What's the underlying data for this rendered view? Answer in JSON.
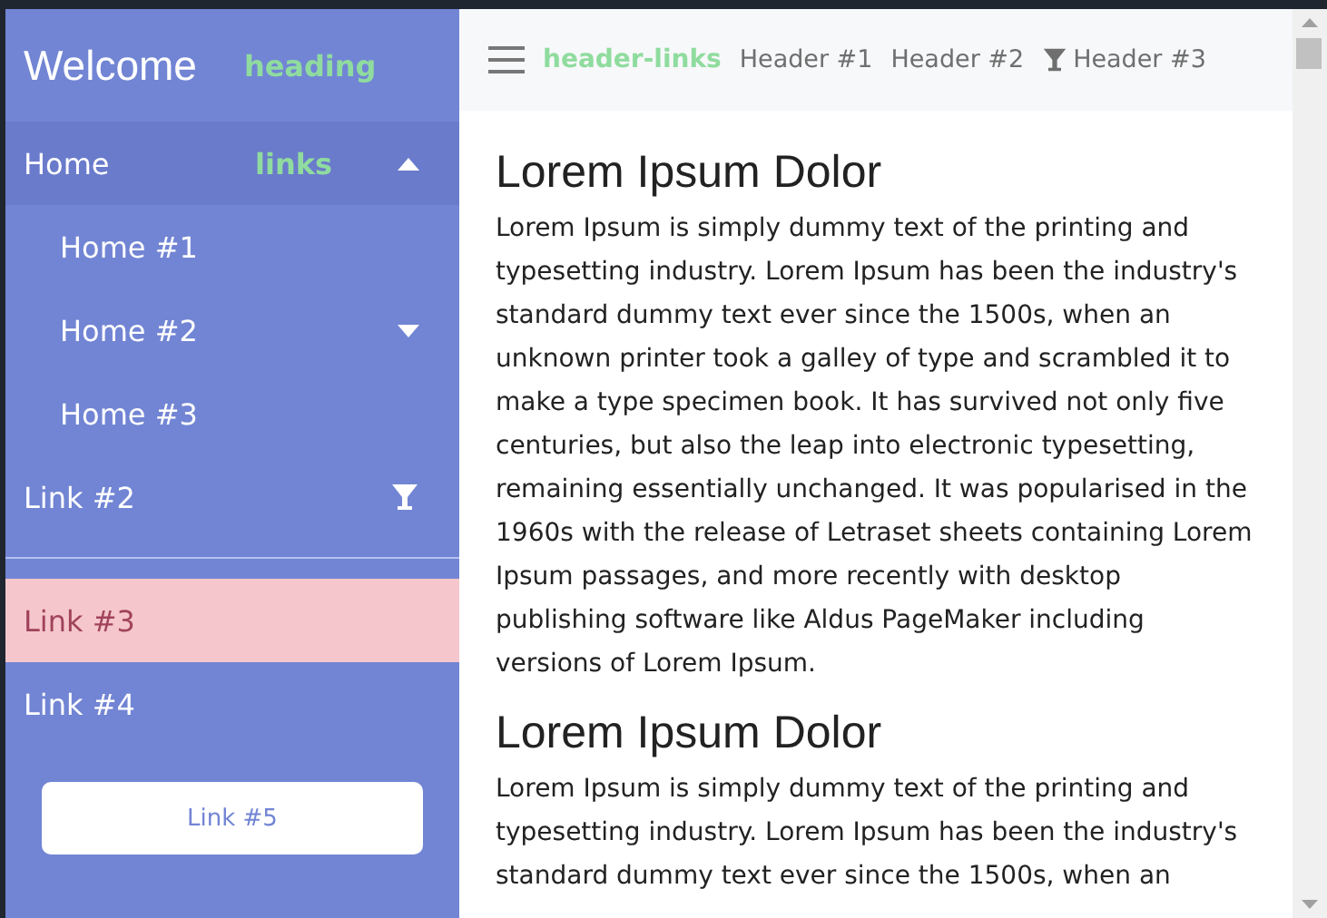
{
  "sidebar": {
    "title": "Welcome",
    "title_tag": "heading",
    "items": [
      {
        "label": "Home",
        "tag": "links",
        "kind": "dropdown",
        "expanded": true,
        "selected": false,
        "children": [
          {
            "label": "Home #1",
            "kind": "link",
            "selected": false
          },
          {
            "label": "Home #2",
            "kind": "dropdown",
            "expanded": false,
            "selected": false
          },
          {
            "label": "Home #3",
            "kind": "link",
            "selected": false
          }
        ]
      },
      {
        "label": "Link #2",
        "kind": "filter",
        "selected": false
      },
      {
        "kind": "divider"
      },
      {
        "label": "Link #3",
        "kind": "link",
        "selected": true
      },
      {
        "label": "Link #4",
        "kind": "link",
        "selected": false
      },
      {
        "label": "Link #5",
        "kind": "button"
      }
    ]
  },
  "header": {
    "tag": "header-links",
    "links": [
      {
        "label": "Header #1",
        "kind": "link"
      },
      {
        "label": "Header #2",
        "kind": "link"
      },
      {
        "label": "Header #3",
        "kind": "filter"
      }
    ]
  },
  "content": [
    {
      "heading": "Lorem Ipsum Dolor",
      "text": "Lorem Ipsum is simply dummy text of the printing and typesetting industry. Lorem Ipsum has been the industry's standard dummy text ever since the 1500s, when an unknown printer took a galley of type and scrambled it to make a type specimen book. It has survived not only five centuries, but also the leap into electronic typesetting, remaining essentially unchanged. It was popularised in the 1960s with the release of Letraset sheets containing Lorem Ipsum passages, and more recently with desktop publishing software like Aldus PageMaker including versions of Lorem Ipsum."
    },
    {
      "heading": "Lorem Ipsum Dolor",
      "text": "Lorem Ipsum is simply dummy text of the printing and typesetting industry. Lorem Ipsum has been the industry's standard dummy text ever since the 1500s, when an"
    }
  ]
}
